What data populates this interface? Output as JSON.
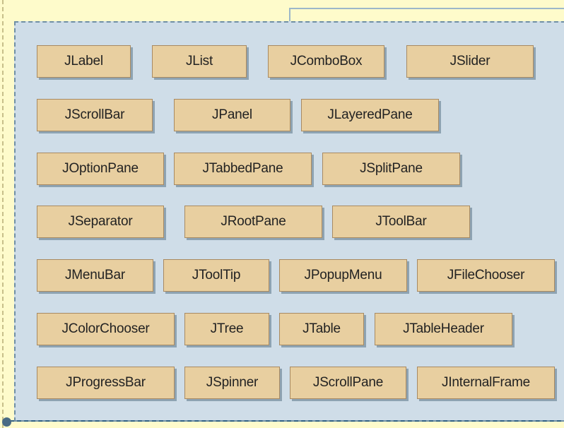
{
  "colors": {
    "page_background": "#fefbcb",
    "panel_background": "#cfdde8",
    "panel_border": "#6f8fa6",
    "box_fill": "#e8cfa0",
    "box_border": "#a88a62",
    "text": "#222222"
  },
  "components": [
    "JLabel",
    "JList",
    "JComboBox",
    "JSlider",
    "JScrollBar",
    "JPanel",
    "JLayeredPane",
    "JOptionPane",
    "JTabbedPane",
    "JSplitPane",
    "JSeparator",
    "JRootPane",
    "JToolBar",
    "JMenuBar",
    "JToolTip",
    "JPopupMenu",
    "JFileChooser",
    "JColorChooser",
    "JTree",
    "JTable",
    "JTableHeader",
    "JProgressBar",
    "JSpinner",
    "JScrollPane",
    "JInternalFrame"
  ]
}
